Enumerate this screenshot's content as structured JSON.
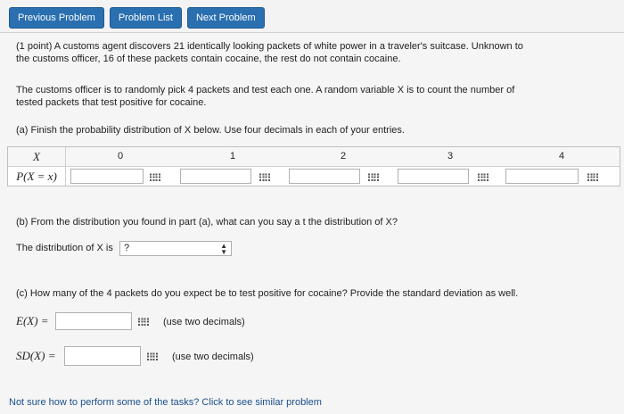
{
  "nav": {
    "previous": "Previous Problem",
    "list": "Problem List",
    "next": "Next Problem"
  },
  "problem": {
    "intro_line1": "(1 point) A customs agent discovers 21 identically looking packets of white power in a traveler's suitcase. Unknown to",
    "intro_line2": "the customs officer, 16 of these packets contain cocaine, the rest do not contain cocaine.",
    "para2_line1": "The customs officer is to randomly pick 4 packets and test each one. A random variable X is to count the number of",
    "para2_line2": "tested packets that test positive for cocaine.",
    "part_a": "(a) Finish the probability distribution of X below. Use four decimals in each of your entries.",
    "part_b": "(b) From the distribution you found in part (a), what can you say a     t the distribution of X?",
    "dist_label": "The distribution of X is",
    "dist_value": "?",
    "part_c": "(c) How many of the 4 packets do you expect be to test positive for cocaine? Provide the standard deviation as well.",
    "ex_label": "E(X) =",
    "ex_hint": "(use two decimals)",
    "sd_label": "SD(X) =",
    "sd_hint": "(use two decimals)",
    "help_link": "Not sure how to perform some of the tasks? Click to see similar problem"
  },
  "table": {
    "x_header": "X",
    "p_header": "P(X = x)",
    "values": [
      "0",
      "1",
      "2",
      "3",
      "4"
    ]
  }
}
